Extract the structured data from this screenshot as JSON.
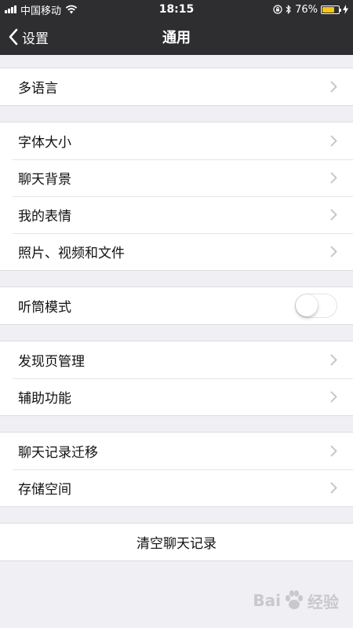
{
  "status_bar": {
    "carrier": "中国移动",
    "time": "18:15",
    "battery_percent": "76%",
    "battery_level": 0.76,
    "battery_color": "#f5c518"
  },
  "nav": {
    "back_label": "设置",
    "title": "通用"
  },
  "groups": [
    {
      "items": [
        {
          "label": "多语言"
        }
      ]
    },
    {
      "items": [
        {
          "label": "字体大小"
        },
        {
          "label": "聊天背景"
        },
        {
          "label": "我的表情"
        },
        {
          "label": "照片、视频和文件"
        }
      ]
    },
    {
      "items": [
        {
          "label": "听筒模式",
          "toggle": false
        }
      ]
    },
    {
      "items": [
        {
          "label": "发现页管理"
        },
        {
          "label": "辅助功能"
        }
      ]
    },
    {
      "items": [
        {
          "label": "聊天记录迁移"
        },
        {
          "label": "存储空间"
        }
      ]
    },
    {
      "items": [
        {
          "label": "清空聊天记录"
        }
      ]
    }
  ],
  "watermark": {
    "text_left": "Bai",
    "text_right": "经验"
  },
  "icons": {
    "back": "chevron-left-icon",
    "row": "chevron-right-icon",
    "wifi": "wifi-icon",
    "lock": "orientation-lock-icon",
    "bluetooth": "bluetooth-icon",
    "charging": "charging-bolt-icon"
  },
  "colors": {
    "nav_background": "#2e2e31",
    "page_background": "#efeff4",
    "chevron": "#c7c7cc"
  }
}
